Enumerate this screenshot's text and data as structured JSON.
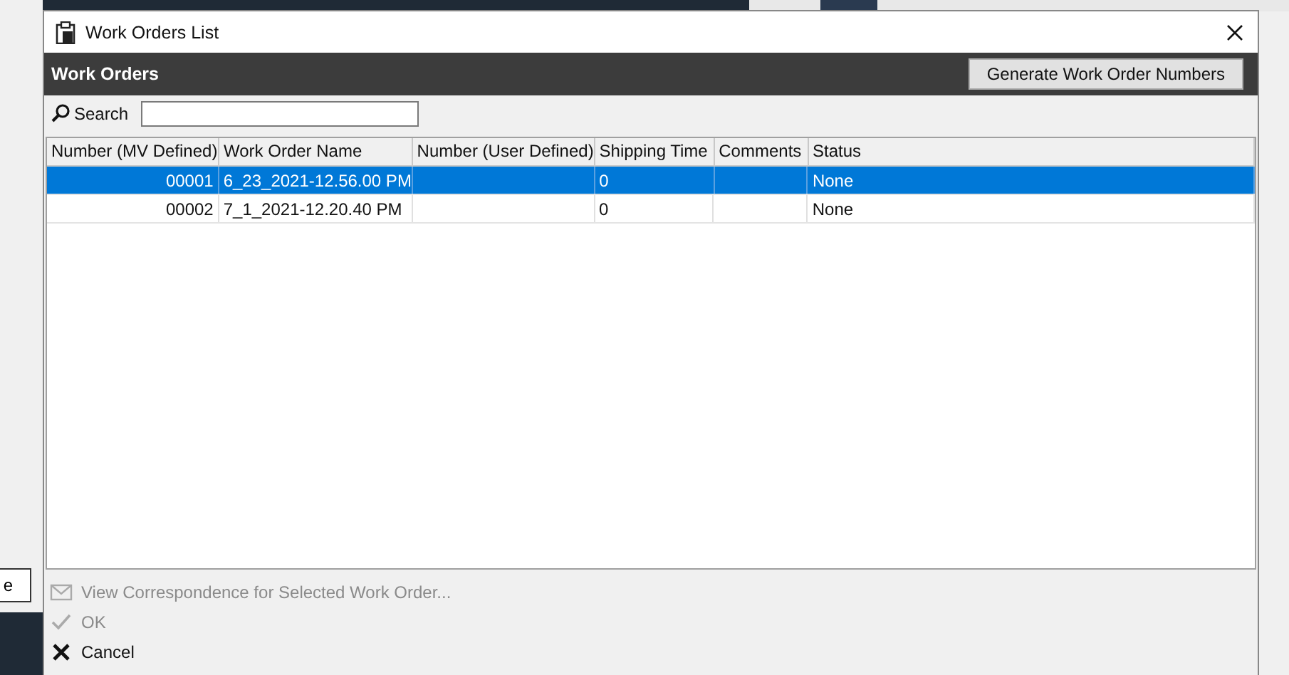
{
  "background": {
    "button_label": "e"
  },
  "window": {
    "title": "Work Orders List"
  },
  "header": {
    "title": "Work Orders",
    "button": "Generate Work Order Numbers"
  },
  "search": {
    "label": "Search"
  },
  "table": {
    "columns": [
      "Number (MV Defined)",
      "Work Order Name",
      "Number (User Defined)",
      "Shipping Time",
      "Comments",
      "Status"
    ],
    "rows": [
      {
        "selected": true,
        "cells": [
          "00001",
          "6_23_2021-12.56.00 PM",
          "",
          "0",
          "",
          "None"
        ]
      },
      {
        "selected": false,
        "cells": [
          "00002",
          "7_1_2021-12.20.40 PM",
          "",
          "0",
          "",
          "None"
        ]
      }
    ]
  },
  "actions": [
    {
      "kind": "mail",
      "label": "View Correspondence for Selected Work Order...",
      "disabled": true
    },
    {
      "kind": "check",
      "label": "OK",
      "disabled": true
    },
    {
      "kind": "cross",
      "label": "Cancel",
      "disabled": false
    }
  ]
}
